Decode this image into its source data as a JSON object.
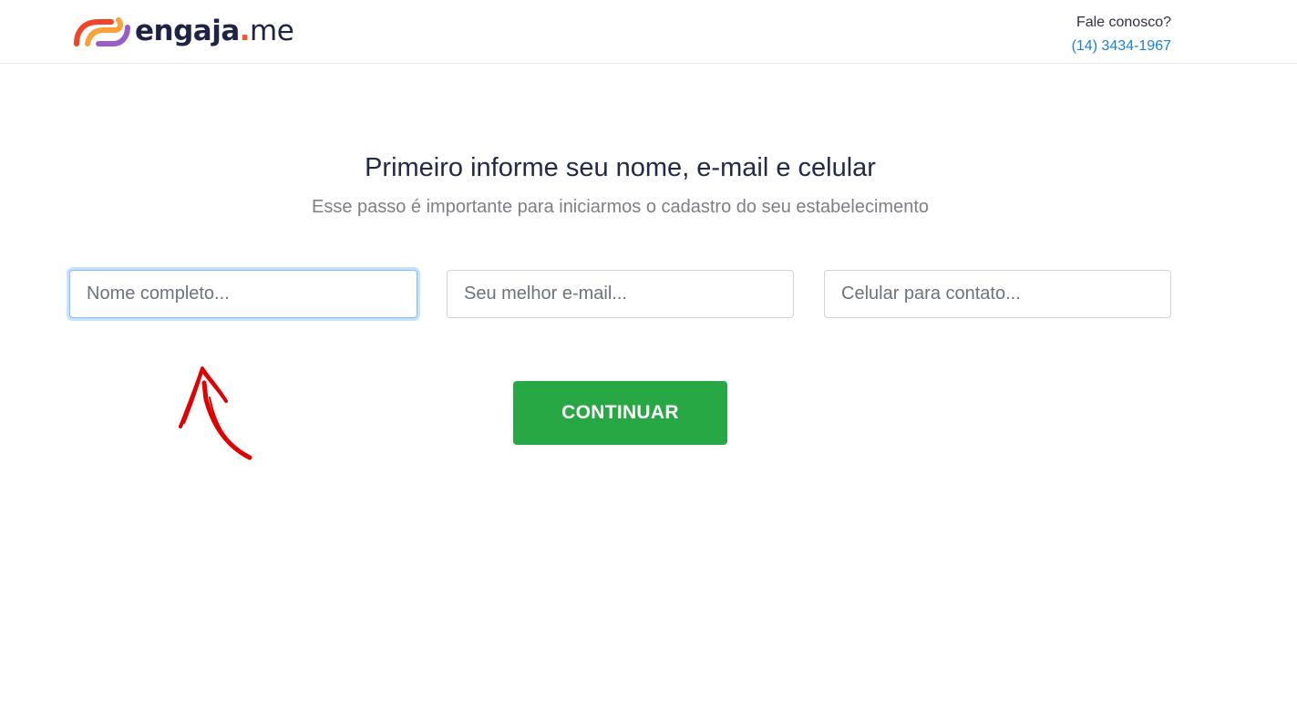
{
  "header": {
    "logo": {
      "brand": "engaja",
      "dot": ".",
      "tld": "me",
      "mark_colors": [
        "#f0452a",
        "#f7a23a",
        "#9a5dc8"
      ]
    },
    "contact": {
      "label": "Fale conosco?",
      "phone": "(14) 3434-1967"
    }
  },
  "main": {
    "title": "Primeiro informe seu nome, e-mail e celular",
    "subtitle": "Esse passo é importante para iniciarmos o cadastro do seu estabelecimento",
    "fields": {
      "name": {
        "placeholder": "Nome completo...",
        "value": ""
      },
      "email": {
        "placeholder": "Seu melhor e-mail...",
        "value": ""
      },
      "phone": {
        "placeholder": "Celular para contato...",
        "value": ""
      }
    },
    "continue_label": "CONTINUAR"
  },
  "annotation": {
    "icon": "red-hand-drawn-arrow-icon",
    "color": "#e00000"
  },
  "colors": {
    "primary_button": "#28a745",
    "link": "#1a7fd6",
    "heading": "#232a45"
  }
}
